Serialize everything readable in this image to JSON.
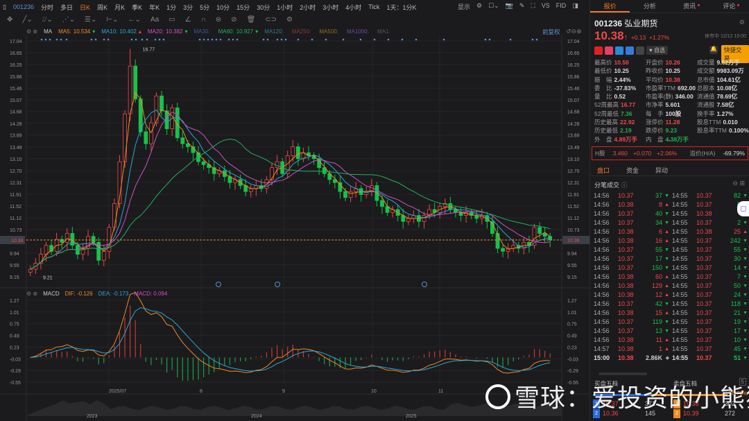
{
  "toolbar": {
    "code": "001236",
    "periods": [
      "分时",
      "多日",
      "日K",
      "周K",
      "月K",
      "季K",
      "年K",
      "1分",
      "3分",
      "5分",
      "10分",
      "15分",
      "30分",
      "1小时",
      "2小时",
      "3小时",
      "4小时",
      "Tick"
    ],
    "active": "日K",
    "range": "1天：1分K",
    "display": "显示",
    "vs": "VS",
    "fid": "FID"
  },
  "legend": {
    "indicator": "MA",
    "items": [
      {
        "label": "MA5:",
        "value": "10.534",
        "dir": "down",
        "color": "#f08a24"
      },
      {
        "label": "MA10:",
        "value": "10.402",
        "dir": "up",
        "color": "#2aa8d8"
      },
      {
        "label": "MA20:",
        "value": "10.382",
        "dir": "down",
        "color": "#d050c8"
      },
      {
        "label": "MA30:",
        "value": "",
        "color": "#3a5a9a"
      },
      {
        "label": "MA60:",
        "value": "10.927",
        "dir": "down",
        "color": "#20b060"
      },
      {
        "label": "MA120:",
        "value": "",
        "color": "#2a7a8a"
      },
      {
        "label": "MA250:",
        "value": "",
        "color": "#8a3a3a"
      },
      {
        "label": "MA500:",
        "value": "",
        "color": "#8a6a2a"
      },
      {
        "label": "MA1000:",
        "value": "",
        "color": "#6a4aa0"
      },
      {
        "label": "MA1:",
        "value": "",
        "color": "#555"
      }
    ],
    "adjust": "前复权"
  },
  "chart_data": {
    "type": "candlestick",
    "yticks": [
      "17.04",
      "16.65",
      "16.25",
      "15.86",
      "15.46",
      "15.07",
      "14.68",
      "14.28",
      "13.89",
      "13.49",
      "13.10",
      "12.70",
      "12.31",
      "11.91",
      "11.52",
      "11.12",
      "10.73",
      "10.38",
      "9.94",
      "9.55",
      "9.15"
    ],
    "ylim": [
      9.15,
      17.04
    ],
    "high_label": "16.77",
    "low_label": "9.21",
    "last": "10.38",
    "closes": [
      9.4,
      9.6,
      9.9,
      10.2,
      10.0,
      10.4,
      10.3,
      10.6,
      10.2,
      9.9,
      10.1,
      10.5,
      10.3,
      9.7,
      10.0,
      10.8,
      11.6,
      13.0,
      14.6,
      16.2,
      15.1,
      14.0,
      13.6,
      14.3,
      15.2,
      14.7,
      14.1,
      14.8,
      13.8,
      13.6,
      13.5,
      13.3,
      13.0,
      12.9,
      12.8,
      12.6,
      12.7,
      12.5,
      12.3,
      12.4,
      12.2,
      12.0,
      12.1,
      12.2,
      12.1,
      12.4,
      12.8,
      13.0,
      12.6,
      13.2,
      13.5,
      13.1,
      13.3,
      13.2,
      13.1,
      12.8,
      12.6,
      12.4,
      12.3,
      12.0,
      11.8,
      12.0,
      12.1,
      11.9,
      12.0,
      12.2,
      11.7,
      11.5,
      11.3,
      11.4,
      11.2,
      11.0,
      11.1,
      11.2,
      11.0,
      11.2,
      11.4,
      11.3,
      11.5,
      11.6,
      11.4,
      11.3,
      11.2,
      11.3,
      11.2,
      11.1,
      11.2,
      11.0,
      10.6,
      10.1,
      10.0,
      10.1,
      10.2,
      10.1,
      10.3,
      10.2,
      10.8,
      10.6,
      10.5,
      10.38
    ],
    "dates": [
      "2025/07",
      "8",
      "9",
      "10",
      "11"
    ],
    "years": [
      "2023",
      "2024",
      "2025"
    ],
    "macd": {
      "name": "MACD",
      "dif": "-0.126",
      "dea": "-0.173",
      "macd": "0.094",
      "yticks": [
        "1.27",
        "1.01",
        "0.75",
        "0.49",
        "0.23",
        "-0.03",
        "-0.29",
        "-0.55"
      ],
      "ylim": [
        -0.55,
        1.27
      ]
    },
    "colors": {
      "up": "#f04848",
      "down": "#16c24a",
      "dif": "#f08a24",
      "dea": "#2aa8d8"
    }
  },
  "panel": {
    "tabs": [
      "报价",
      "分析",
      "资讯",
      "评论"
    ],
    "code": "001236",
    "name": "弘业期货",
    "price": "10.38",
    "change": "+0.13",
    "pct": "+1.27%",
    "status": "休市中 12/12 15:00",
    "watch": "自选",
    "quick_trade": "快捷交易",
    "stats": [
      [
        [
          "最高价",
          "10.50",
          "red"
        ],
        [
          "开盘价",
          "10.26",
          "red"
        ],
        [
          "成交量",
          "9.62万手",
          "wht"
        ]
      ],
      [
        [
          "最低价",
          "10.25",
          "wht"
        ],
        [
          "昨收价",
          "10.25",
          "wht"
        ],
        [
          "成交额",
          "9983.09万",
          "wht"
        ]
      ],
      [
        [
          "振　幅",
          "2.44%",
          "wht"
        ],
        [
          "平均价",
          "10.38",
          "red"
        ],
        [
          "总市值",
          "104.61亿",
          "wht"
        ]
      ],
      [
        [
          "委　比",
          "-37.83%",
          "wht"
        ],
        [
          "市盈率TTM",
          "692.00",
          "wht"
        ],
        [
          "总股本",
          "10.08亿",
          "wht"
        ]
      ],
      [
        [
          "量　比",
          "0.52",
          "wht"
        ],
        [
          "市盈率(静)",
          "346.00",
          "wht"
        ],
        [
          "流通值",
          "78.69亿",
          "wht"
        ]
      ],
      [
        [
          "52周最高",
          "16.77",
          "red"
        ],
        [
          "市净率",
          "5.601",
          "wht"
        ],
        [
          "流通股",
          "7.58亿",
          "wht"
        ]
      ],
      [
        [
          "52周最低",
          "7.36",
          "green"
        ],
        [
          "每　手",
          "100股",
          "wht"
        ],
        [
          "换手率",
          "1.27%",
          "wht"
        ]
      ],
      [
        [
          "历史最高",
          "22.92",
          "red"
        ],
        [
          "涨停价",
          "11.28",
          "red"
        ],
        [
          "股息TTM",
          "0.010",
          "wht"
        ]
      ],
      [
        [
          "历史最低",
          "2.19",
          "green"
        ],
        [
          "跌停价",
          "9.23",
          "green"
        ],
        [
          "股息率TTM",
          "0.100%",
          "wht"
        ]
      ],
      [
        [
          "外　盘",
          "4.89万手",
          "red"
        ],
        [
          "内　盘",
          "4.38万手",
          "green"
        ]
      ]
    ],
    "hshare": {
      "label": "H股",
      "price": "3.460",
      "chg": "+0.070",
      "pct": "+2.06%",
      "prem_label": "溢价(H/A)",
      "prem": "-69.79%"
    },
    "subtabs": [
      "盘口",
      "资金",
      "异动"
    ],
    "ticks_title": "分笔成交",
    "trades_left": [
      [
        "14:56",
        "10.37",
        "37",
        "d"
      ],
      [
        "14:56",
        "10.38",
        "8",
        "u"
      ],
      [
        "14:56",
        "10.37",
        "40",
        "d"
      ],
      [
        "14:56",
        "10.37",
        "34",
        "d"
      ],
      [
        "14:56",
        "10.38",
        "6",
        "u"
      ],
      [
        "14:56",
        "10.38",
        "16",
        "u"
      ],
      [
        "14:56",
        "10.37",
        "55",
        "d"
      ],
      [
        "14:56",
        "10.37",
        "17",
        "d"
      ],
      [
        "14:56",
        "10.37",
        "150",
        "d"
      ],
      [
        "14:56",
        "10.38",
        "60",
        "u"
      ],
      [
        "14:56",
        "10.38",
        "129",
        "u"
      ],
      [
        "14:56",
        "10.38",
        "12",
        "u"
      ],
      [
        "14:56",
        "10.37",
        "42",
        "d"
      ],
      [
        "14:56",
        "10.38",
        "15",
        "u"
      ],
      [
        "14:56",
        "10.37",
        "119",
        "d"
      ],
      [
        "14:56",
        "10.37",
        "13",
        "d"
      ],
      [
        "14:56",
        "10.38",
        "11",
        "u"
      ],
      [
        "14:57",
        "10.38",
        "1",
        "u"
      ],
      [
        "15:00",
        "10.38",
        "2.86K",
        "n"
      ]
    ],
    "trades_right": [
      [
        "14:55",
        "10.37",
        "82",
        "d"
      ],
      [
        "14:55",
        "10.37",
        "5",
        "d"
      ],
      [
        "14:55",
        "10.38",
        "",
        ""
      ],
      [
        "14:55",
        "10.37",
        "2",
        "d"
      ],
      [
        "14:55",
        "10.38",
        "25",
        "u"
      ],
      [
        "14:55",
        "10.37",
        "242",
        "d"
      ],
      [
        "14:55",
        "10.37",
        "55",
        "d"
      ],
      [
        "14:55",
        "10.37",
        "30",
        "d"
      ],
      [
        "14:55",
        "10.37",
        "14",
        "d"
      ],
      [
        "14:55",
        "10.37",
        "7",
        "d"
      ],
      [
        "14:55",
        "10.37",
        "50",
        "d"
      ],
      [
        "14:55",
        "10.37",
        "24",
        "d"
      ],
      [
        "14:55",
        "10.37",
        "118",
        "d"
      ],
      [
        "14:55",
        "10.37",
        "21",
        "d"
      ],
      [
        "14:55",
        "10.37",
        "19",
        "d"
      ],
      [
        "14:55",
        "10.37",
        "17",
        "d"
      ],
      [
        "14:55",
        "10.37",
        "10",
        "d"
      ],
      [
        "14:55",
        "10.37",
        "45",
        "d"
      ],
      [
        "14:55",
        "10.37",
        "51",
        "d"
      ]
    ],
    "book": {
      "buy_title": "买盘五档",
      "sell_title": "卖盘五档",
      "ratio": "56.76%",
      "count": "5",
      "buy": [
        [
          "1",
          "10.37",
          "371"
        ],
        [
          "2",
          "10.36",
          "145"
        ]
      ],
      "sell": [
        [
          "1",
          "10.38",
          "302"
        ],
        [
          "2",
          "10.39",
          "272"
        ]
      ]
    }
  },
  "watermark": "雪球：爱投资的小熊猫"
}
